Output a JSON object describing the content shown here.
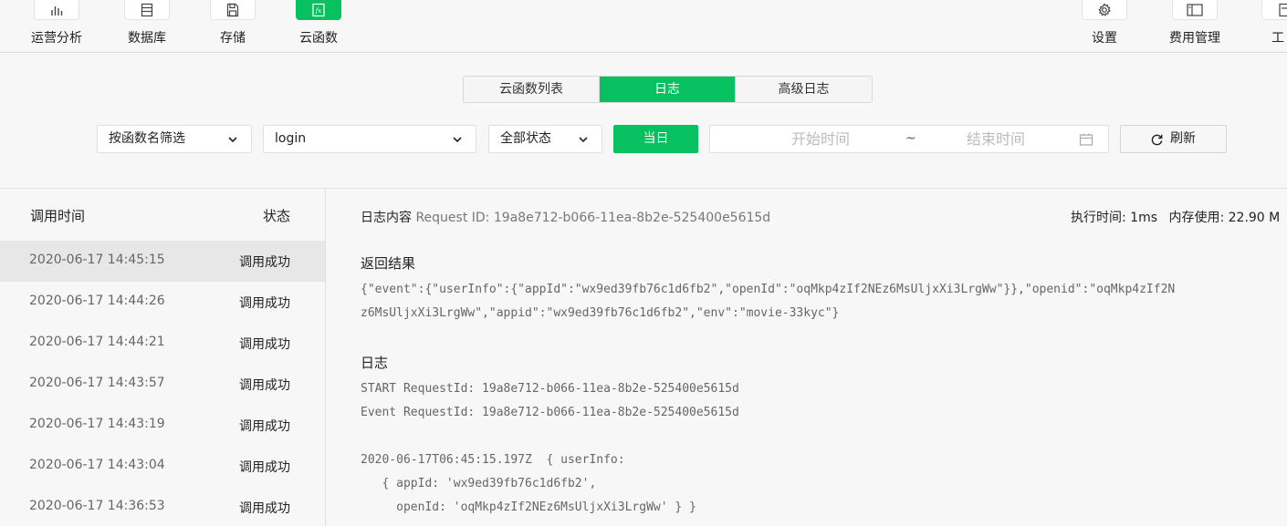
{
  "toolbar": {
    "left": [
      {
        "label": "运营分析",
        "icon": "bar-chart-icon"
      },
      {
        "label": "数据库",
        "icon": "database-icon"
      },
      {
        "label": "存储",
        "icon": "storage-icon"
      },
      {
        "label": "云函数",
        "icon": "function-icon",
        "active": true
      }
    ],
    "right": [
      {
        "label": "设置",
        "icon": "gear-icon"
      },
      {
        "label": "费用管理",
        "icon": "billing-icon"
      },
      {
        "label": "工",
        "icon": "tool-icon"
      }
    ]
  },
  "tabs": [
    {
      "label": "云函数列表"
    },
    {
      "label": "日志",
      "active": true
    },
    {
      "label": "高级日志"
    }
  ],
  "filters": {
    "filter_mode": "按函数名筛选",
    "function_name": "login",
    "status": "全部状态",
    "today_button": "当日",
    "start_placeholder": "开始时间",
    "range_separator": "~",
    "end_placeholder": "结束时间",
    "refresh_button": "刷新"
  },
  "list": {
    "col_time": "调用时间",
    "col_status": "状态",
    "rows": [
      {
        "time": "2020-06-17 14:45:15",
        "status": "调用成功",
        "selected": true
      },
      {
        "time": "2020-06-17 14:44:26",
        "status": "调用成功"
      },
      {
        "time": "2020-06-17 14:44:21",
        "status": "调用成功"
      },
      {
        "time": "2020-06-17 14:43:57",
        "status": "调用成功"
      },
      {
        "time": "2020-06-17 14:43:19",
        "status": "调用成功"
      },
      {
        "time": "2020-06-17 14:43:04",
        "status": "调用成功"
      },
      {
        "time": "2020-06-17 14:36:53",
        "status": "调用成功"
      }
    ]
  },
  "detail": {
    "header_label": "日志内容",
    "request_id_text": "Request ID: 19a8e712-b066-11ea-8b2e-525400e5615d",
    "exec_time": "执行时间: 1ms",
    "memory": "内存使用: 22.90 M",
    "result_title": "返回结果",
    "result_line1": "{\"event\":{\"userInfo\":{\"appId\":\"wx9ed39fb76c1d6fb2\",\"openId\":\"oqMkp4zIf2NEz6MsUljxXi3LrgWw\"}},\"openid\":\"oqMkp4zIf2N",
    "result_line2": "z6MsUljxXi3LrgWw\",\"appid\":\"wx9ed39fb76c1d6fb2\",\"env\":\"movie-33kyc\"}",
    "log_title": "日志",
    "log_line1": "START RequestId: 19a8e712-b066-11ea-8b2e-525400e5615d",
    "log_line2": "Event RequestId: 19a8e712-b066-11ea-8b2e-525400e5615d",
    "log_line3": "2020-06-17T06:45:15.197Z  { userInfo:",
    "log_line4": "   { appId: 'wx9ed39fb76c1d6fb2',",
    "log_line5": "     openId: 'oqMkp4zIf2NEz6MsUljxXi3LrgWw' } }"
  }
}
